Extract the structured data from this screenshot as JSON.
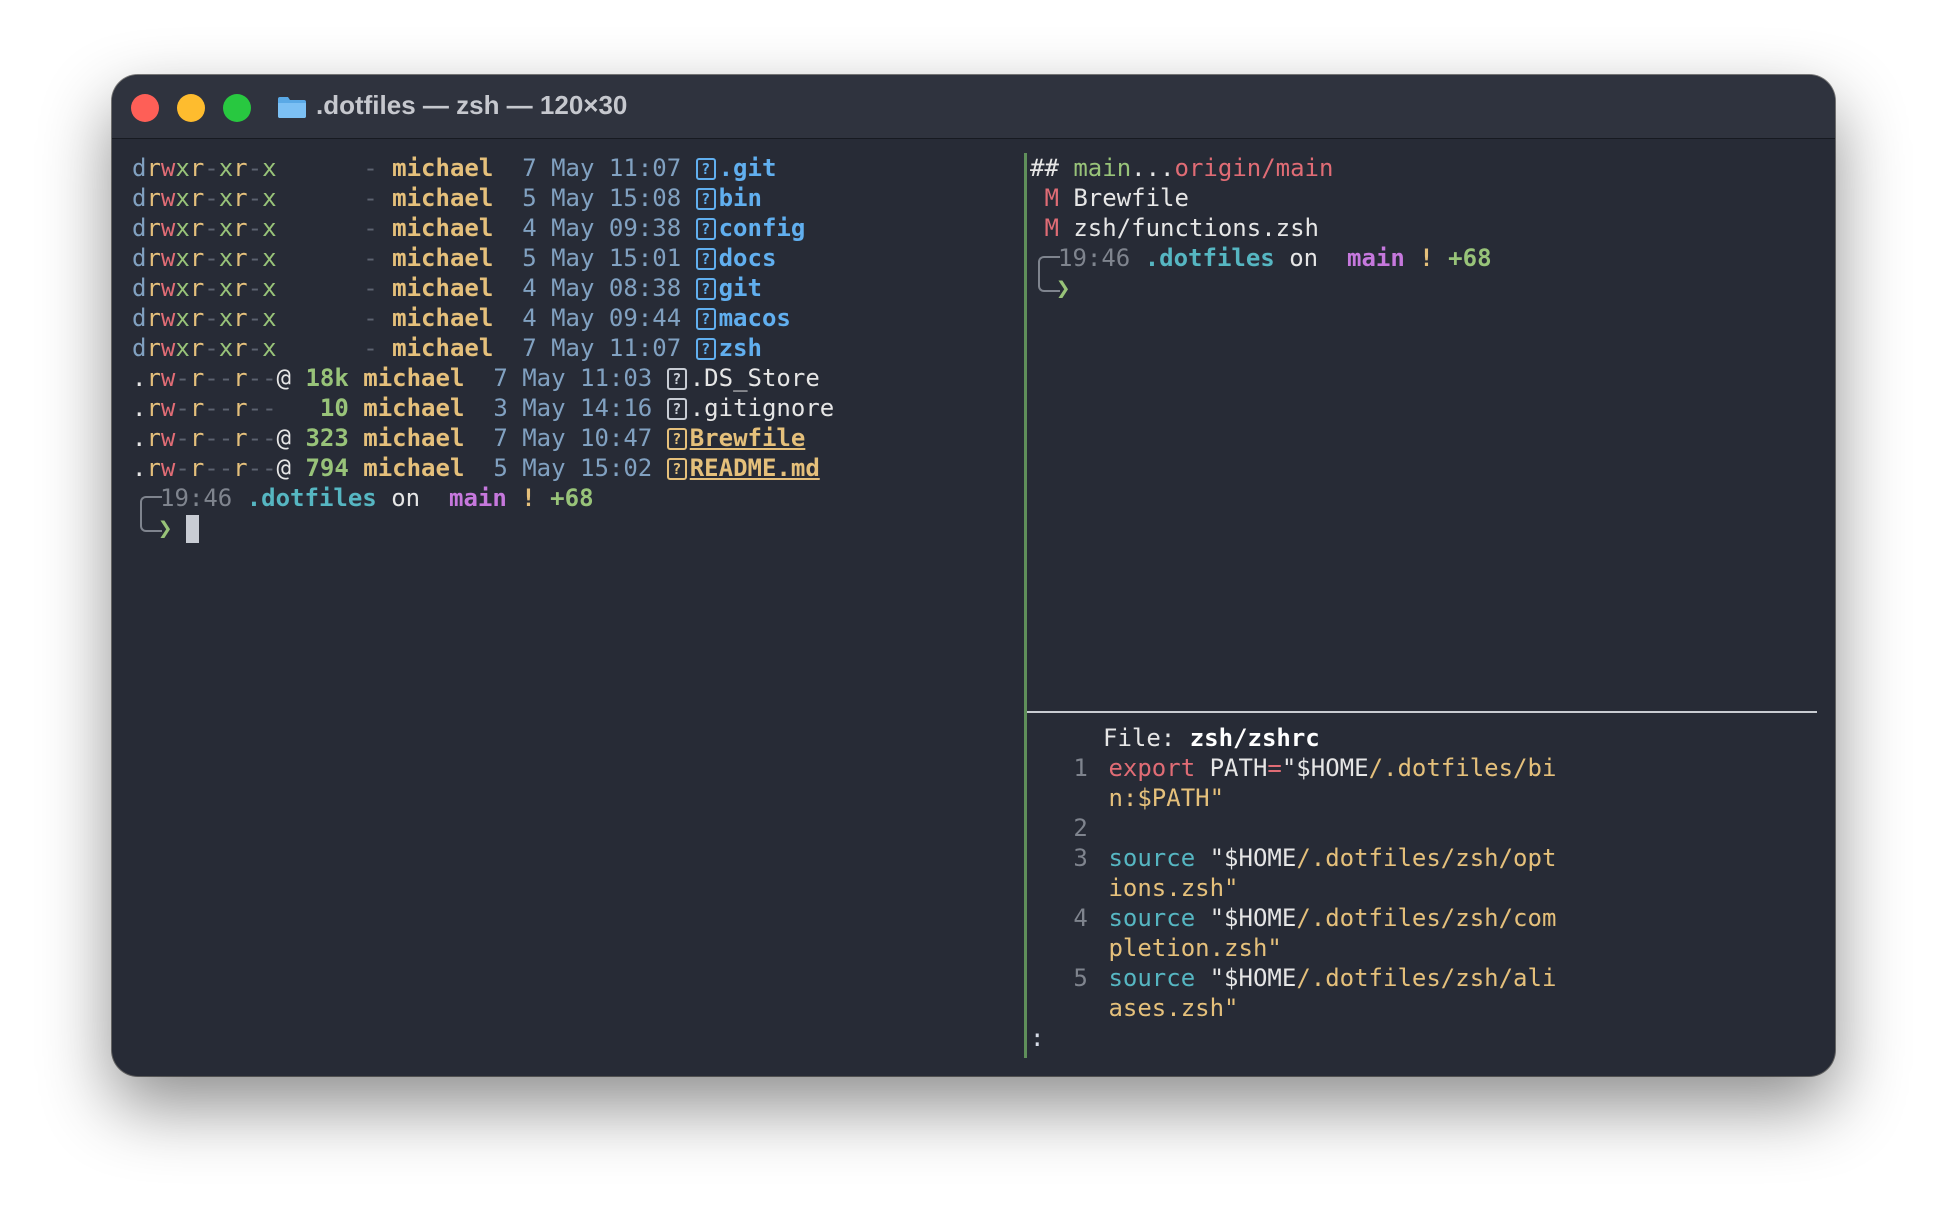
{
  "window": {
    "title": ".dotfiles — zsh — 120×30"
  },
  "listing": [
    {
      "perm_type": "d",
      "r1": "r",
      "w1": "w",
      "x1": "x",
      "g": "-xr-x",
      "size": "-",
      "user": "michael",
      "date": "7 May 11:07",
      "name": ".git",
      "kind": "dir"
    },
    {
      "perm_type": "d",
      "r1": "r",
      "w1": "w",
      "x1": "x",
      "g": "-xr-x",
      "size": "-",
      "user": "michael",
      "date": "5 May 15:08",
      "name": "bin",
      "kind": "dir"
    },
    {
      "perm_type": "d",
      "r1": "r",
      "w1": "w",
      "x1": "x",
      "g": "-xr-x",
      "size": "-",
      "user": "michael",
      "date": "4 May 09:38",
      "name": "config",
      "kind": "dir"
    },
    {
      "perm_type": "d",
      "r1": "r",
      "w1": "w",
      "x1": "x",
      "g": "-xr-x",
      "size": "-",
      "user": "michael",
      "date": "5 May 15:01",
      "name": "docs",
      "kind": "dir"
    },
    {
      "perm_type": "d",
      "r1": "r",
      "w1": "w",
      "x1": "x",
      "g": "-xr-x",
      "size": "-",
      "user": "michael",
      "date": "4 May 08:38",
      "name": "git",
      "kind": "dir"
    },
    {
      "perm_type": "d",
      "r1": "r",
      "w1": "w",
      "x1": "x",
      "g": "-xr-x",
      "size": "-",
      "user": "michael",
      "date": "4 May 09:44",
      "name": "macos",
      "kind": "dir"
    },
    {
      "perm_type": "d",
      "r1": "r",
      "w1": "w",
      "x1": "x",
      "g": "-xr-x",
      "size": "-",
      "user": "michael",
      "date": "7 May 11:07",
      "name": "zsh",
      "kind": "dir"
    },
    {
      "perm_type": ".",
      "attr": "@",
      "size": "18k",
      "user": "michael",
      "date": "7 May 11:03",
      "name": ".DS_Store",
      "kind": "file"
    },
    {
      "perm_type": ".",
      "attr": "",
      "size": "10",
      "user": "michael",
      "date": "3 May 14:16",
      "name": ".gitignore",
      "kind": "file"
    },
    {
      "perm_type": ".",
      "attr": "@",
      "size": "323",
      "user": "michael",
      "date": "7 May 10:47",
      "name": "Brewfile",
      "kind": "special"
    },
    {
      "perm_type": ".",
      "attr": "@",
      "size": "794",
      "user": "michael",
      "date": "5 May 15:02",
      "name": "README.md",
      "kind": "special"
    }
  ],
  "prompt": {
    "time": "19:46",
    "dir": ".dotfiles",
    "on": "on",
    "branch_icon": "",
    "branch": "main",
    "bang": "!",
    "plus": "+68",
    "arrow": "❯"
  },
  "git_status": {
    "header_hash": "##",
    "header_local": "main",
    "header_sep": "...",
    "header_remote": "origin/main",
    "files": [
      {
        "flag": "M",
        "path": "Brewfile"
      },
      {
        "flag": "M",
        "path": "zsh/functions.zsh"
      }
    ]
  },
  "viewer": {
    "file_label": "File:",
    "file_name": "zsh/zshrc",
    "lines": [
      {
        "n": "1",
        "kw": "export",
        "kw_type": "export",
        "rest": " PATH",
        "eq": "=",
        "str1": "\"$HOME",
        "str2": "/.dotfiles/bi"
      },
      {
        "n": "",
        "cont": "n:$PATH\""
      },
      {
        "n": "2"
      },
      {
        "n": "3",
        "kw": "source",
        "kw_type": "source",
        "rest": " ",
        "str1": "\"$HOME",
        "str2": "/.dotfiles/zsh/opt"
      },
      {
        "n": "",
        "cont": "ions.zsh\""
      },
      {
        "n": "4",
        "kw": "source",
        "kw_type": "source",
        "rest": " ",
        "str1": "\"$HOME",
        "str2": "/.dotfiles/zsh/com"
      },
      {
        "n": "",
        "cont": "pletion.zsh\""
      },
      {
        "n": "5",
        "kw": "source",
        "kw_type": "source",
        "rest": " ",
        "str1": "\"$HOME",
        "str2": "/.dotfiles/zsh/ali"
      },
      {
        "n": "",
        "cont": "ases.zsh\""
      }
    ],
    "pager_prompt": ":"
  },
  "colors": {
    "background": "#272b36",
    "titlebar": "#2f333e",
    "split": "#5f8f5a"
  }
}
